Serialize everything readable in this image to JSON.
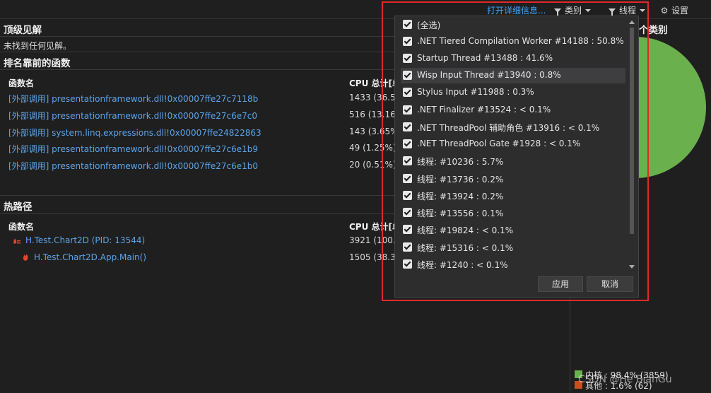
{
  "toolbar": {
    "open_details": "打开详细信息...",
    "category": "类别",
    "thread": "线程",
    "settings": "设置"
  },
  "top_insights": {
    "title": "顶级见解",
    "empty": "未找到任何见解。"
  },
  "top_functions": {
    "title": "排名靠前的函数",
    "col_function": "函数名",
    "col_cpu": "CPU 总计[单",
    "rows": [
      {
        "name": "[外部调用] presentationframework.dll!0x00007ffe27c7118b",
        "cpu": "1433 (36.55"
      },
      {
        "name": "[外部调用] presentationframework.dll!0x00007ffe27c6e7c0",
        "cpu": "516 (13.16%"
      },
      {
        "name": "[外部调用] system.linq.expressions.dll!0x00007ffe24822863",
        "cpu": "143 (3.65%)"
      },
      {
        "name": "[外部调用] presentationframework.dll!0x00007ffe27c6e1b9",
        "cpu": "49 (1.25%)"
      },
      {
        "name": "[外部调用] presentationframework.dll!0x00007ffe27c6e1b0",
        "cpu": "20 (0.51%)"
      }
    ]
  },
  "hot_path": {
    "title": "热路径",
    "col_function": "函数名",
    "col_cpu": "CPU 总计[单",
    "rows": [
      {
        "name": "H.Test.Chart2D (PID: 13544)",
        "cpu": "3921 (100.0"
      },
      {
        "name": "H.Test.Chart2D.App.Main()",
        "cpu": "1505 (38.38"
      }
    ]
  },
  "right_pane": {
    "title_fragment": "个类别",
    "legend": [
      {
        "label": "内核 : 98.4% (3859)",
        "color": "#6ab04c"
      },
      {
        "label": "其他 : 1.6% (62)",
        "color": "#c8501e"
      }
    ]
  },
  "chart_data": {
    "type": "pie",
    "categories": [
      "内核",
      "其他"
    ],
    "values": [
      98.4,
      1.6
    ],
    "counts": [
      3859,
      62
    ],
    "colors": [
      "#6ab04c",
      "#c8501e"
    ]
  },
  "thread_filter": {
    "options": [
      {
        "label": "(全选)",
        "checked": true
      },
      {
        "label": ".NET Tiered Compilation Worker #14188 : 50.8%",
        "checked": true
      },
      {
        "label": "Startup Thread #13488 : 41.6%",
        "checked": true
      },
      {
        "label": "Wisp Input Thread #13940 : 0.8%",
        "checked": true
      },
      {
        "label": "Stylus Input #11988 : 0.3%",
        "checked": true
      },
      {
        "label": ".NET Finalizer #13524 : < 0.1%",
        "checked": true
      },
      {
        "label": ".NET ThreadPool 辅助角色 #13916 : < 0.1%",
        "checked": true
      },
      {
        "label": ".NET ThreadPool Gate #1928 : < 0.1%",
        "checked": true
      },
      {
        "label": "线程: #10236 : 5.7%",
        "checked": true
      },
      {
        "label": "线程: #13736 : 0.2%",
        "checked": true
      },
      {
        "label": "线程: #13924 : 0.2%",
        "checked": true
      },
      {
        "label": "线程: #13556 : 0.1%",
        "checked": true
      },
      {
        "label": "线程: #19824 : < 0.1%",
        "checked": true
      },
      {
        "label": "线程: #15316 : < 0.1%",
        "checked": true
      },
      {
        "label": "线程: #1240 : < 0.1%",
        "checked": true
      }
    ],
    "apply": "应用",
    "cancel": "取消"
  },
  "watermark": "CSDN @He BianGu"
}
